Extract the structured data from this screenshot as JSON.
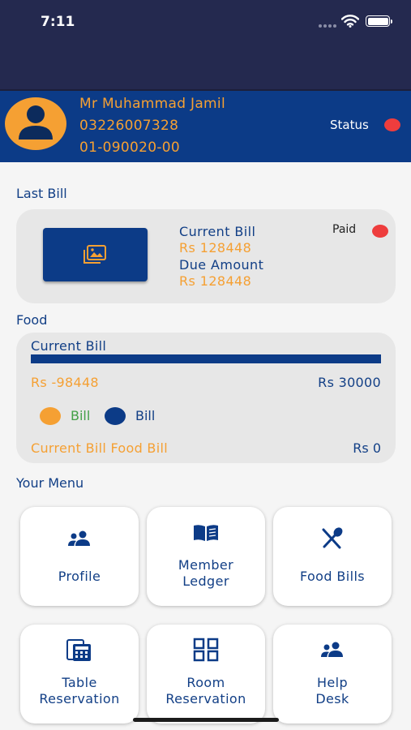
{
  "status_bar": {
    "time": "7:11"
  },
  "member": {
    "name": "Mr Muhammad Jamil",
    "phone": "03226007328",
    "code": "01-090020-00",
    "status_label": "Status"
  },
  "last_bill": {
    "section_title": "Last Bill",
    "current_bill_label": "Current Bill",
    "current_bill_value": "Rs 128448",
    "due_amount_label": "Due Amount",
    "due_amount_value": "Rs 128448",
    "payment_status": "Paid"
  },
  "food": {
    "section_title": "Food",
    "current_bill_label": "Current Bill",
    "progress_fraction": 1.0,
    "spent_value": "Rs -98448",
    "limit_value": "Rs 30000",
    "legend": [
      "Bill",
      "Bill"
    ],
    "food_bill_label": "Current Bill Food Bill",
    "food_bill_value": "Rs 0"
  },
  "menu": {
    "section_title": "Your Menu",
    "tiles": [
      {
        "label": "Profile",
        "icon": "people-icon"
      },
      {
        "label": "Member\nLedger",
        "icon": "book-icon"
      },
      {
        "label": "Food Bills",
        "icon": "fork-knife-icon"
      },
      {
        "label": "Table\nReservation",
        "icon": "calculator-icon"
      },
      {
        "label": "Room\nReservation",
        "icon": "grid-icon"
      },
      {
        "label": "Help\nDesk",
        "icon": "people-icon"
      }
    ]
  },
  "colors": {
    "header_bg": "#24294f",
    "brand_blue": "#0c3b87",
    "accent_orange": "#f5a033",
    "status_red": "#ee3d3d",
    "legend_green": "#43a047"
  }
}
